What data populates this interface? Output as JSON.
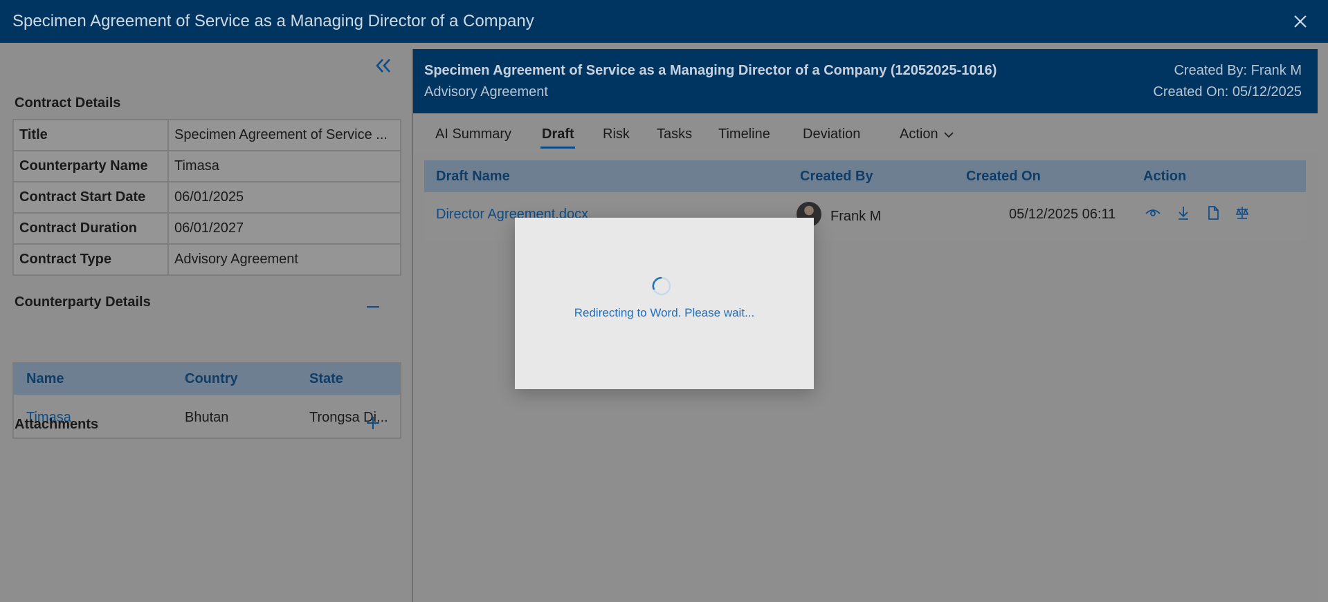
{
  "window": {
    "title": "Specimen Agreement of Service as a Managing Director of a Company"
  },
  "left": {
    "contract_details_title": "Contract Details",
    "details": [
      {
        "label": "Title",
        "value": "Specimen Agreement of Service ..."
      },
      {
        "label": "Counterparty Name",
        "value": "Timasa"
      },
      {
        "label": "Contract Start Date",
        "value": "06/01/2025"
      },
      {
        "label": "Contract Duration",
        "value": "06/01/2027"
      },
      {
        "label": "Contract Type",
        "value": "Advisory Agreement"
      }
    ],
    "counterparty_title": "Counterparty Details",
    "counterparty_headers": {
      "name": "Name",
      "country": "Country",
      "state": "State"
    },
    "counterparty_row": {
      "name": "Timasa",
      "country": "Bhutan",
      "state": "Trongsa Di..."
    },
    "attachments_title": "Attachments"
  },
  "right": {
    "header_title": "Specimen Agreement of Service as a Managing Director of a Company (12052025-1016)",
    "header_subtitle": "Advisory Agreement",
    "created_by": "Created By: Frank M",
    "created_on": "Created On: 05/12/2025",
    "tabs": [
      "AI Summary",
      "Draft",
      "Risk",
      "Tasks",
      "Timeline",
      "Deviation",
      "Action"
    ],
    "active_tab": "Draft",
    "grid_headers": {
      "draft_name": "Draft Name",
      "created_by": "Created By",
      "created_on": "Created On",
      "action": "Action"
    },
    "grid_row": {
      "draft_name": "Director Agreement.docx",
      "created_by": "Frank M",
      "created_on": "05/12/2025 06:11"
    }
  },
  "modal": {
    "message": "Redirecting to Word. Please wait..."
  },
  "colors": {
    "brand": "#003562",
    "link": "#1f6fbf",
    "annotation_arrow": "#e81010"
  }
}
